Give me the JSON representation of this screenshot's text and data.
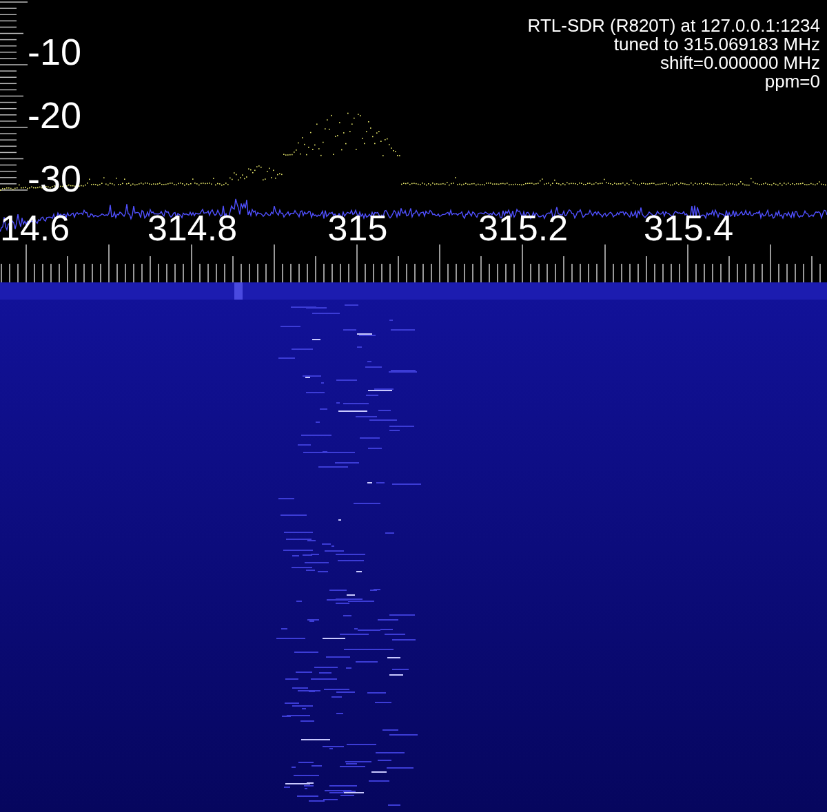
{
  "info": {
    "lines": [
      "RTL-SDR (R820T) at 127.0.0.1:1234",
      "tuned to 315.069183 MHz",
      "shift=0.000000 MHz",
      "ppm=0"
    ]
  },
  "y_axis": {
    "labels": [
      "-10",
      "-20",
      "-30"
    ]
  },
  "x_axis": {
    "labels": [
      "14.6",
      "314.8",
      "315",
      "315.2",
      "315.4"
    ]
  }
}
